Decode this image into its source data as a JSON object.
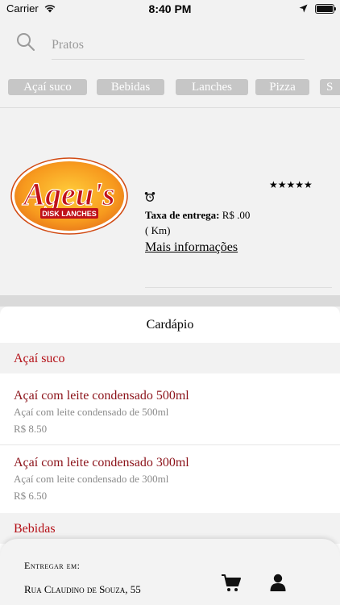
{
  "status_bar": {
    "carrier": "Carrier",
    "time": "8:40 PM",
    "battery_level": 1.0
  },
  "search": {
    "placeholder": "Pratos",
    "icon": "search-icon"
  },
  "categories": [
    "Açaí suco",
    "Bebidas",
    "Lanches",
    "Pizza",
    "S"
  ],
  "restaurant": {
    "logo_text": "Ageu's",
    "logo_subtext": "DISK LANCHES",
    "rating_stars": "★★★★★",
    "rating": 5,
    "fee_label": "Taxa de entrega:",
    "fee_value": "R$ .00",
    "distance": "( Km)",
    "more_info": "Mais informações"
  },
  "menu": {
    "title": "Cardápio",
    "sections": [
      {
        "name": "Açaí suco",
        "items": [
          {
            "name": "Açaí com leite condensado 500ml",
            "description": "Açaí com leite condensado de 500ml",
            "price": "R$ 8.50"
          },
          {
            "name": "Açaí com leite condensado 300ml",
            "description": "Açaí com leite condensado de 300ml",
            "price": "R$ 6.50"
          }
        ]
      },
      {
        "name": "Bebidas",
        "items": []
      }
    ]
  },
  "delivery": {
    "label": "Entregar em:",
    "address": "Rua Claudino de Souza, 55"
  },
  "colors": {
    "accent": "#b40f16",
    "item_title": "#8b1219",
    "chip_bg": "#c6c6c6"
  }
}
